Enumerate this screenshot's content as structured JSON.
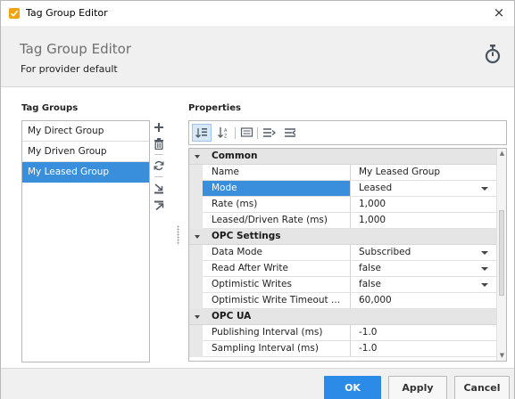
{
  "window": {
    "title": "Tag Group Editor",
    "close_glyph": "×"
  },
  "header": {
    "title": "Tag Group Editor",
    "subtitle": "For provider default"
  },
  "tag_groups": {
    "label": "Tag Groups",
    "items": [
      {
        "label": "My Direct Group",
        "selected": false
      },
      {
        "label": "My Driven Group",
        "selected": false
      },
      {
        "label": "My Leased Group",
        "selected": true
      }
    ],
    "tools": [
      "add-icon",
      "delete-icon",
      "refresh-icon",
      "import-icon",
      "export-icon"
    ]
  },
  "properties": {
    "label": "Properties",
    "toolbar": [
      "sort-categorized-icon",
      "sort-alphabetical-icon",
      "description-toggle-icon",
      "expand-all-icon",
      "collapse-all-icon"
    ],
    "categories": [
      {
        "name": "Common",
        "rows": [
          {
            "name": "Name",
            "value": "My Leased Group",
            "dropdown": false,
            "selected": false
          },
          {
            "name": "Mode",
            "value": "Leased",
            "dropdown": true,
            "selected": true
          },
          {
            "name": "Rate (ms)",
            "value": "1,000",
            "dropdown": false,
            "selected": false
          },
          {
            "name": "Leased/Driven Rate (ms)",
            "value": "1,000",
            "dropdown": false,
            "selected": false
          }
        ]
      },
      {
        "name": "OPC Settings",
        "rows": [
          {
            "name": "Data Mode",
            "value": "Subscribed",
            "dropdown": true,
            "selected": false
          },
          {
            "name": "Read After Write",
            "value": "false",
            "dropdown": true,
            "selected": false
          },
          {
            "name": "Optimistic Writes",
            "value": "false",
            "dropdown": true,
            "selected": false
          },
          {
            "name": "Optimistic Write Timeout ...",
            "value": "60,000",
            "dropdown": false,
            "selected": false
          }
        ]
      },
      {
        "name": "OPC UA",
        "rows": [
          {
            "name": "Publishing Interval (ms)",
            "value": "-1.0",
            "dropdown": false,
            "selected": false
          },
          {
            "name": "Sampling Interval (ms)",
            "value": "-1.0",
            "dropdown": false,
            "selected": false
          }
        ]
      }
    ]
  },
  "footer": {
    "ok_label": "OK",
    "apply_label": "Apply",
    "cancel_label": "Cancel"
  },
  "colors": {
    "accent": "#3a8fdc",
    "ok_button": "#2d8be8",
    "app_icon": "#f0a30a"
  }
}
